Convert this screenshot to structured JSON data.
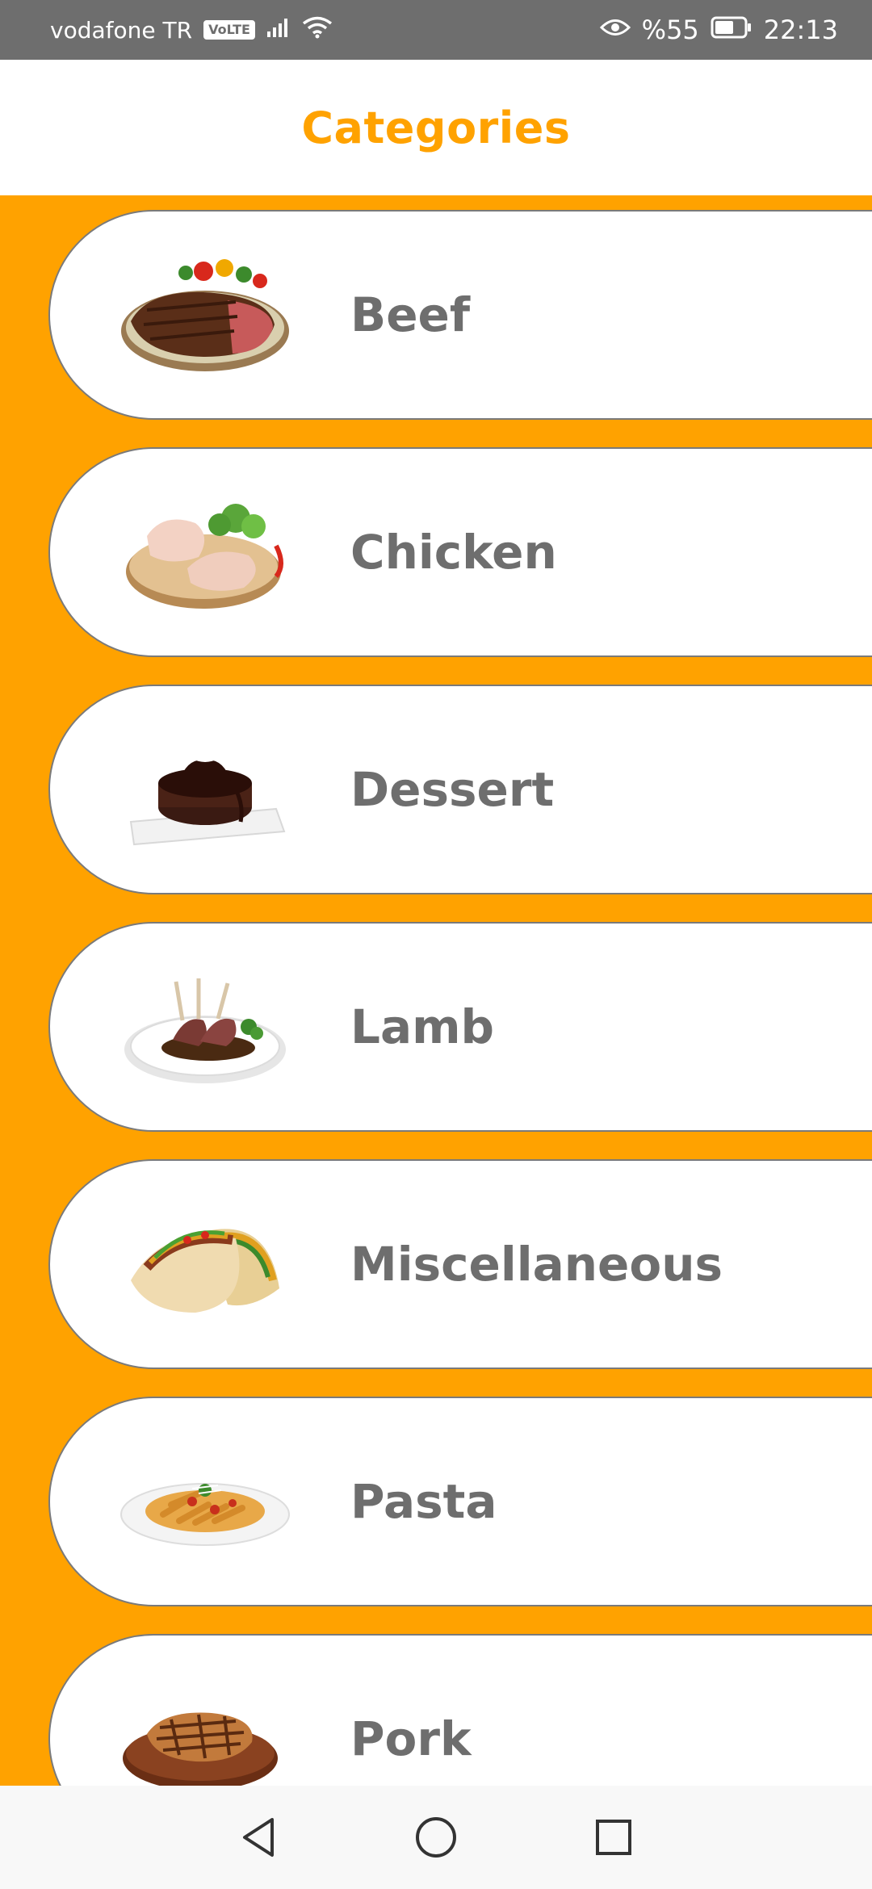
{
  "status_bar": {
    "carrier": "vodafone TR",
    "volte": "VoLTE",
    "battery_pct": "%55",
    "time": "22:13"
  },
  "app_bar": {
    "title": "Categories"
  },
  "categories": [
    {
      "label": "Beef",
      "icon": "beef-steak-image"
    },
    {
      "label": "Chicken",
      "icon": "chicken-legs-image"
    },
    {
      "label": "Dessert",
      "icon": "chocolate-cake-image"
    },
    {
      "label": "Lamb",
      "icon": "lamb-chops-image"
    },
    {
      "label": "Miscellaneous",
      "icon": "tacos-image"
    },
    {
      "label": "Pasta",
      "icon": "penne-pasta-image"
    },
    {
      "label": "Pork",
      "icon": "pork-chop-image"
    }
  ],
  "colors": {
    "accent": "#ffa200",
    "label": "#6e6e6e",
    "status_bar": "#6e6e6e"
  },
  "nav_bar": {
    "icons": [
      "back-icon",
      "home-icon",
      "recents-icon"
    ]
  }
}
